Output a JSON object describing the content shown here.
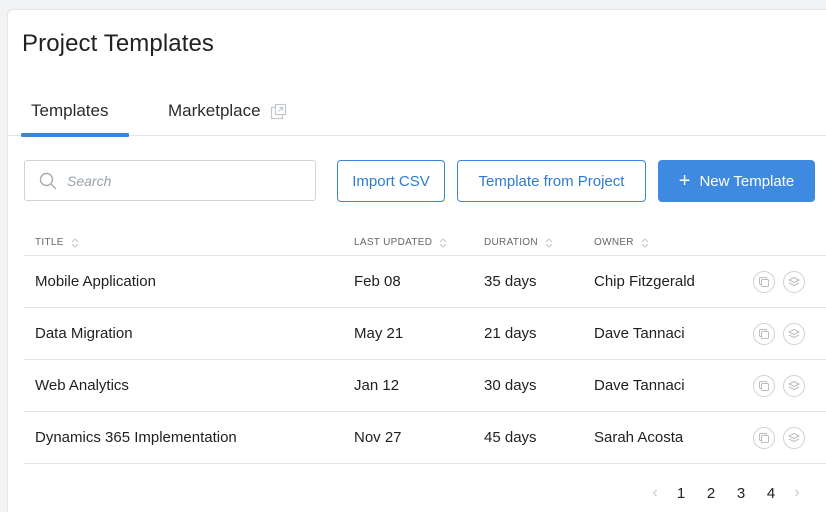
{
  "page": {
    "title": "Project Templates"
  },
  "tabs": [
    {
      "label": "Templates",
      "active": true
    },
    {
      "label": "Marketplace",
      "active": false,
      "icon": "external-link-icon"
    }
  ],
  "toolbar": {
    "search_placeholder": "Search",
    "import_label": "Import CSV",
    "from_project_label": "Template from Project",
    "new_template_label": "New Template",
    "new_template_icon": "+"
  },
  "table": {
    "columns": [
      "TITLE",
      "LAST UPDATED",
      "DURATION",
      "OWNER"
    ],
    "rows": [
      {
        "title": "Mobile Application",
        "updated": "Feb 08",
        "duration": "35 days",
        "owner": "Chip Fitzgerald"
      },
      {
        "title": "Data Migration",
        "updated": "May 21",
        "duration": "21 days",
        "owner": "Dave Tannaci"
      },
      {
        "title": "Web Analytics",
        "updated": "Jan 12",
        "duration": "30 days",
        "owner": "Dave Tannaci"
      },
      {
        "title": "Dynamics 365 Implementation",
        "updated": "Nov 27",
        "duration": "45 days",
        "owner": "Sarah Acosta"
      }
    ]
  },
  "pagination": {
    "pages": [
      "1",
      "2",
      "3",
      "4"
    ],
    "prev": "‹",
    "next": "›"
  },
  "colors": {
    "accent": "#3d8ae0",
    "border": "#e3e5e8",
    "icon_gray": "#b9bec3"
  }
}
